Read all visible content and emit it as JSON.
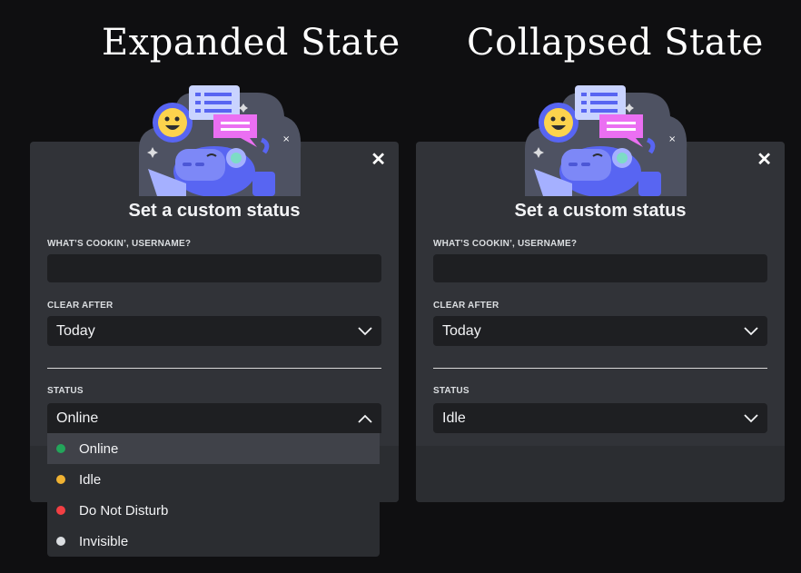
{
  "headings": {
    "expanded": "Expanded State",
    "collapsed": "Collapsed State"
  },
  "modal": {
    "close_glyph": "✕",
    "title": "Set a custom status",
    "custom_status_label": "WHAT’S COOKIN’, USERNAME?",
    "custom_status_value": "",
    "clear_after_label": "CLEAR AFTER",
    "clear_after_value": "Today",
    "status_label": "STATUS"
  },
  "expanded": {
    "status_value": "Online"
  },
  "collapsed": {
    "status_value": "Idle"
  },
  "status_options": [
    {
      "label": "Online",
      "color": "#23a55a",
      "selected": true
    },
    {
      "label": "Idle",
      "color": "#f0b232",
      "selected": false
    },
    {
      "label": "Do Not Disturb",
      "color": "#f23f43",
      "selected": false
    },
    {
      "label": "Invisible",
      "color": "#dbdee1",
      "selected": false
    }
  ],
  "colors": {
    "background": "#0f0f11",
    "modal": "#313338",
    "input": "#1e1f22",
    "accent": "#5865f2"
  },
  "icons": {
    "close": "close-icon",
    "chevron_down": "chevron-down-icon",
    "chevron_up": "chevron-up-icon"
  }
}
